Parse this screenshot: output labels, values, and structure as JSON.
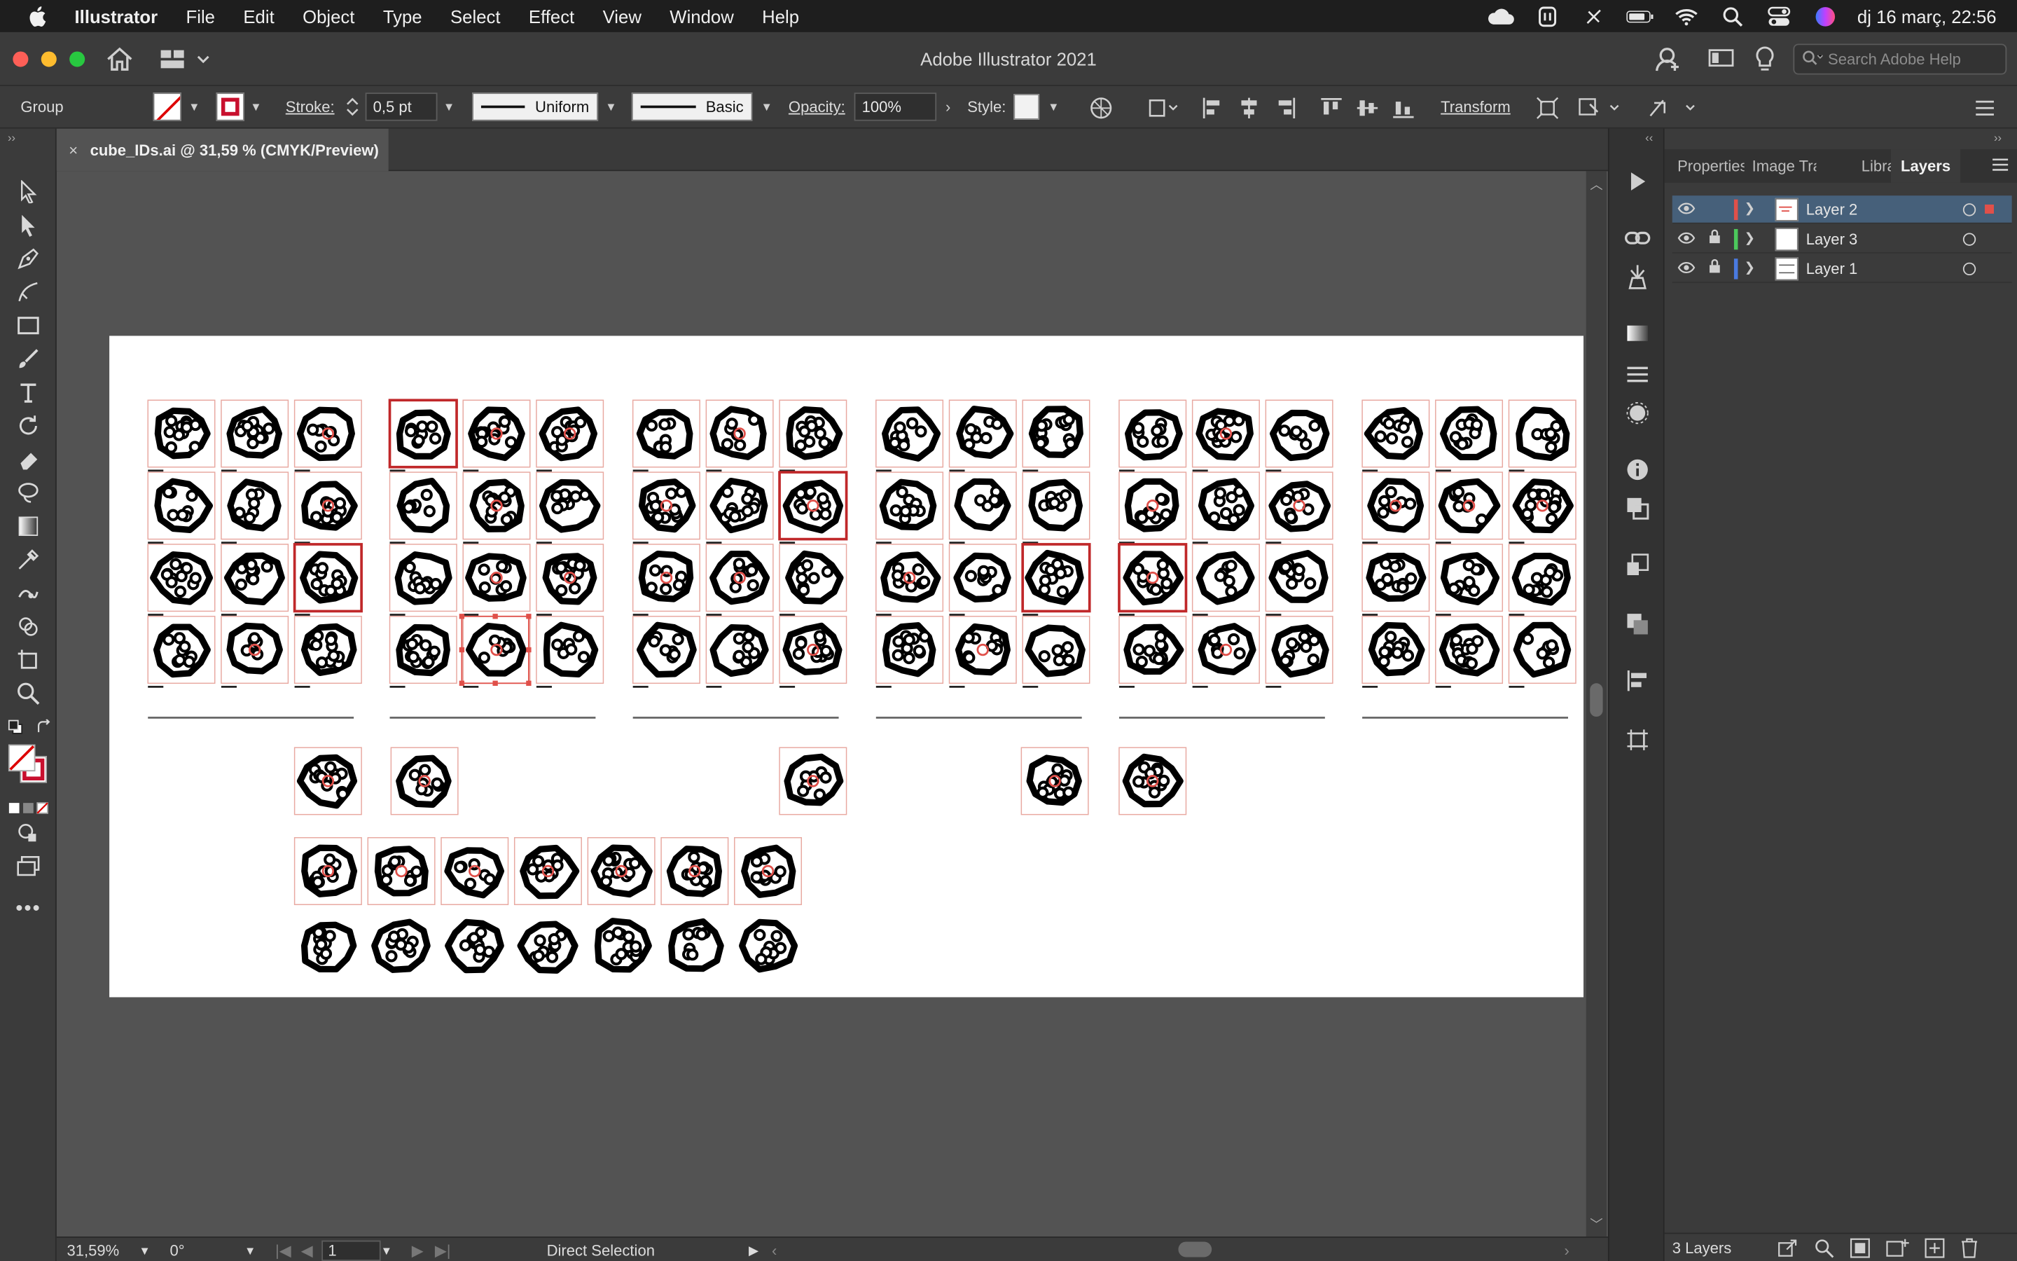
{
  "menubar": {
    "app_name": "Illustrator",
    "items": [
      "File",
      "Edit",
      "Object",
      "Type",
      "Select",
      "Effect",
      "View",
      "Window",
      "Help"
    ],
    "clock": "dj 16 març, 22:56"
  },
  "titlebar": {
    "title": "Adobe Illustrator 2021",
    "search_placeholder": "Search Adobe Help"
  },
  "controlbar": {
    "selection_type": "Group",
    "stroke_label": "Stroke:",
    "stroke_weight": "0,5 pt",
    "profile_label": "Uniform",
    "brush_label": "Basic",
    "opacity_label": "Opacity:",
    "opacity_value": "100%",
    "style_label": "Style:",
    "transform_label": "Transform",
    "stroke_color": "#c8102e"
  },
  "document": {
    "tab_title": "cube_IDs.ai @ 31,59 % (CMYK/Preview)",
    "close_glyph": "×"
  },
  "statusbar": {
    "zoom": "31,59%",
    "rotation": "0°",
    "artboard_number": "1",
    "tool_name": "Direct Selection"
  },
  "layers_panel": {
    "tabs": [
      "Properties",
      "Image Trace",
      "Libraries",
      "Layers"
    ],
    "active_tab": "Layers",
    "layers": [
      {
        "name": "Layer 2",
        "color": "#e0504a",
        "locked": false,
        "selected": true
      },
      {
        "name": "Layer 3",
        "color": "#4cc85c",
        "locked": true,
        "selected": false
      },
      {
        "name": "Layer 1",
        "color": "#4a7ae0",
        "locked": true,
        "selected": false
      }
    ],
    "count_label": "3 Layers"
  },
  "colors": {
    "accent": "#e0504a",
    "selection_blue": "#46607a",
    "artboard": "#ffffff"
  }
}
